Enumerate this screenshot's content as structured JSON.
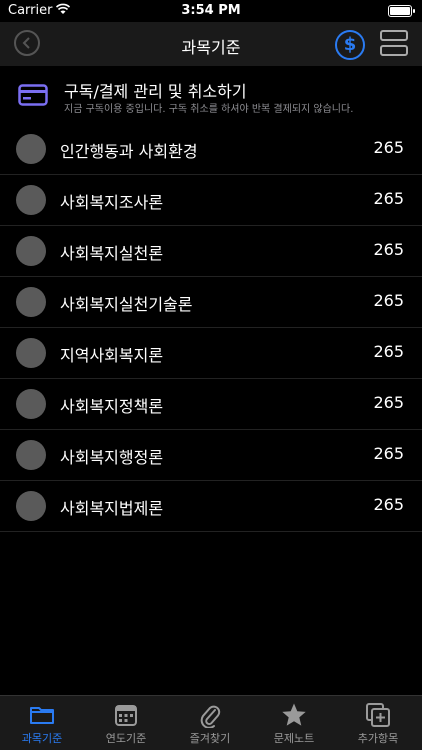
{
  "status_bar": {
    "carrier": "Carrier",
    "time": "3:54 PM",
    "icons": [
      "wifi-icon",
      "battery-icon"
    ]
  },
  "nav": {
    "title": "과목기준",
    "back_icon": "back-chevron-icon",
    "dollar_label": "$",
    "accent_color": "#2a7bf2"
  },
  "subscription": {
    "icon": "credit-card-icon",
    "heading": "구독/결제 관리 및 취소하기",
    "description": "지금 구독이용 중입니다. 구독 취소를 하셔야 반복 결제되지 않습니다."
  },
  "subjects": [
    {
      "label": "인간행동과 사회환경",
      "count": "265"
    },
    {
      "label": "사회복지조사론",
      "count": "265"
    },
    {
      "label": "사회복지실천론",
      "count": "265"
    },
    {
      "label": "사회복지실천기술론",
      "count": "265"
    },
    {
      "label": "지역사회복지론",
      "count": "265"
    },
    {
      "label": "사회복지정책론",
      "count": "265"
    },
    {
      "label": "사회복지행정론",
      "count": "265"
    },
    {
      "label": "사회복지법제론",
      "count": "265"
    }
  ],
  "tabs": [
    {
      "label": "과목기준",
      "icon": "folder-icon",
      "active": true
    },
    {
      "label": "연도기준",
      "icon": "calendar-icon",
      "active": false
    },
    {
      "label": "즐겨찾기",
      "icon": "paperclip-icon",
      "active": false
    },
    {
      "label": "문제노트",
      "icon": "star-icon",
      "active": false
    },
    {
      "label": "추가항목",
      "icon": "add-square-icon",
      "active": false
    }
  ]
}
